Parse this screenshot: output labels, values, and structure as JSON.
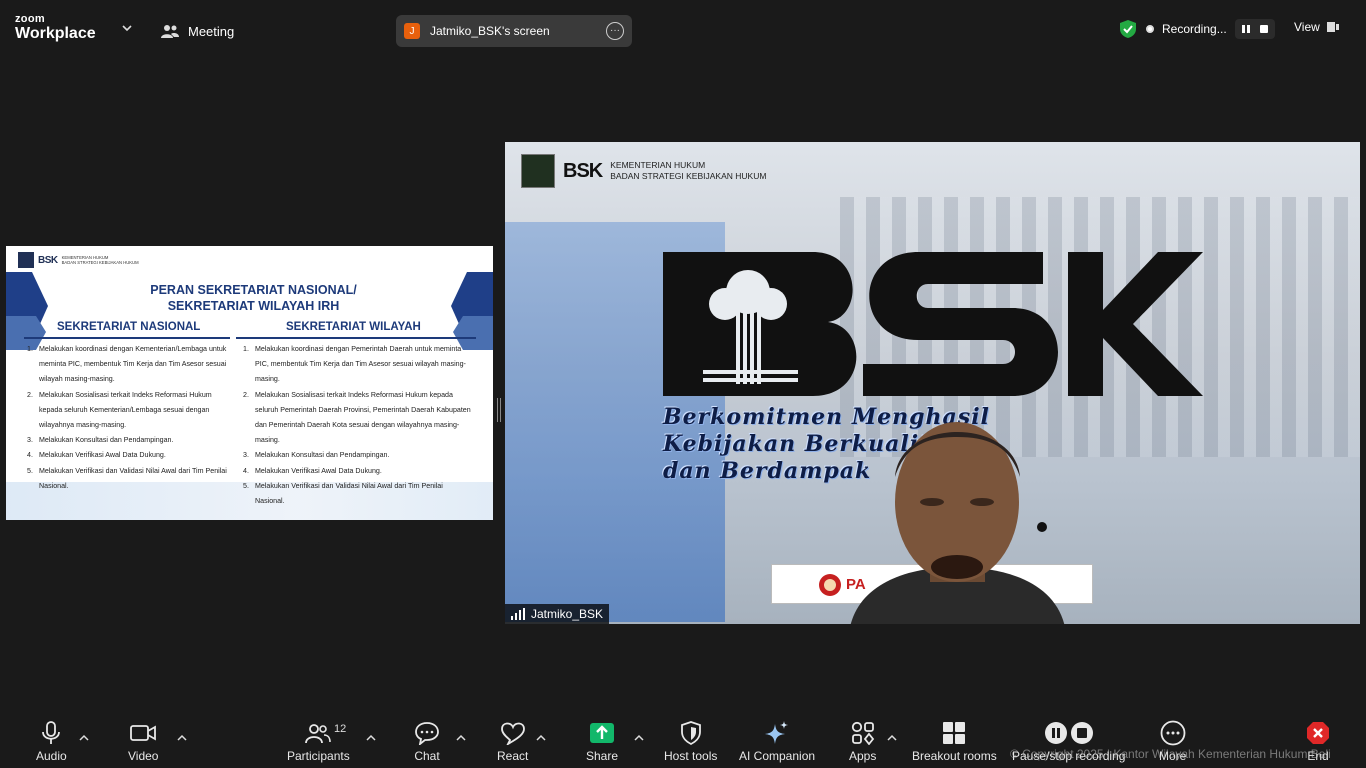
{
  "topbar": {
    "logo_line1": "zoom",
    "logo_line2": "Workplace",
    "meeting_label": "Meeting",
    "share_pill": {
      "avatar_letter": "J",
      "name": "Jatmiko_BSK's screen"
    },
    "recording_label": "Recording...",
    "view_label": "View"
  },
  "slide": {
    "logo_text": "BSK",
    "org_line1": "KEMENTERIAN HUKUM",
    "org_line2": "BADAN STRATEGI KEBIJAKAN HUKUM",
    "title_line1": "PERAN SEKRETARIAT NASIONAL/",
    "title_line2": "SEKRETARIAT WILAYAH IRH",
    "col_left": {
      "heading": "SEKRETARIAT NASIONAL",
      "items": [
        "Melakukan koordinasi dengan Kementerian/Lembaga untuk meminta PIC, membentuk Tim Kerja dan Tim Asesor sesuai wilayah masing-masing.",
        "Melakukan Sosialisasi terkait Indeks Reformasi Hukum kepada seluruh Kementerian/Lembaga sesuai dengan wilayahnya masing-masing.",
        "Melakukan Konsultasi dan Pendampingan.",
        "Melakukan Verifikasi Awal Data Dukung.",
        "Melakukan Verifikasi dan Validasi Nilai Awal dari Tim Penilai Nasional."
      ]
    },
    "col_right": {
      "heading": "SEKRETARIAT WILAYAH",
      "items": [
        "Melakukan koordinasi dengan Pemerintah Daerah untuk meminta PIC, membentuk Tim Kerja dan Tim Asesor sesuai wilayah masing-masing.",
        "Melakukan Sosialisasi terkait Indeks Reformasi Hukum kepada seluruh Pemerintah Daerah Provinsi, Pemerintah Daerah Kabupaten dan Pemerintah Daerah Kota sesuai dengan wilayahnya masing-masing.",
        "Melakukan Konsultasi dan Pendampingan.",
        "Melakukan Verifikasi Awal Data Dukung.",
        "Melakukan Verifikasi dan Validasi Nilai Awal dari Tim Penilai Nasional."
      ]
    }
  },
  "video": {
    "logo_text": "BSK",
    "org_line1": "KEMENTERIAN HUKUM",
    "org_line2": "BADAN STRATEGI KEBIJAKAN HUKUM",
    "tagline_line1": "Berkomitmen Menghasil",
    "tagline_line2": "Kebijakan Berkualit",
    "tagline_line3": "dan Berdampak",
    "banner_text": "PA",
    "participant_name": "Jatmiko_BSK"
  },
  "toolbar": {
    "audio": "Audio",
    "video": "Video",
    "participants": "Participants",
    "participants_count": "12",
    "chat": "Chat",
    "react": "React",
    "share": "Share",
    "host_tools": "Host tools",
    "ai_companion": "AI Companion",
    "apps": "Apps",
    "breakout_rooms": "Breakout rooms",
    "pause_stop_recording": "Pause/stop recording",
    "more": "More",
    "end": "End",
    "copyright": "© Copyright 2025 | Kantor Wilayah Kementerian Hukum Bali"
  },
  "colors": {
    "background": "#1a1a1a",
    "share_green": "#12b76a",
    "end_red": "#e02828",
    "security_green": "#23a942",
    "slide_navy": "#1d3a7a"
  }
}
